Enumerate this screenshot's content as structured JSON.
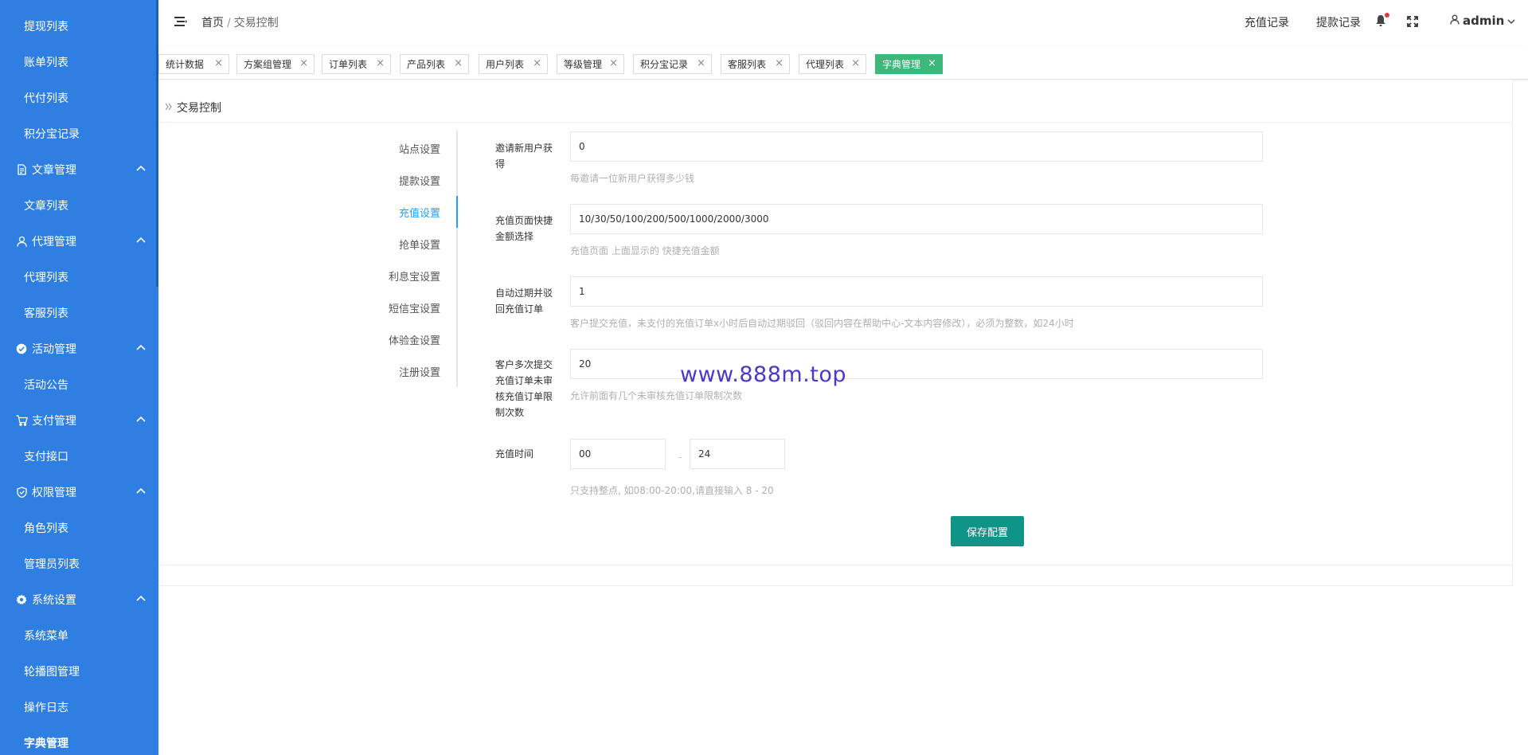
{
  "colors": {
    "sidebar_bg": "#2f7fe3",
    "accent": "#1e9fff",
    "tab_active": "#3cb87a",
    "save_button": "#119488"
  },
  "sidebar": {
    "items": [
      {
        "label": "提现列表",
        "type": "sub"
      },
      {
        "label": "账单列表",
        "type": "sub"
      },
      {
        "label": "代付列表",
        "type": "sub"
      },
      {
        "label": "积分宝记录",
        "type": "sub"
      },
      {
        "label": "文章管理",
        "type": "group",
        "icon": "document-icon"
      },
      {
        "label": "文章列表",
        "type": "sub"
      },
      {
        "label": "代理管理",
        "type": "group",
        "icon": "user-icon"
      },
      {
        "label": "代理列表",
        "type": "sub"
      },
      {
        "label": "客服列表",
        "type": "sub"
      },
      {
        "label": "活动管理",
        "type": "group",
        "icon": "activity-icon"
      },
      {
        "label": "活动公告",
        "type": "sub"
      },
      {
        "label": "支付管理",
        "type": "group",
        "icon": "cart-icon"
      },
      {
        "label": "支付接口",
        "type": "sub"
      },
      {
        "label": "权限管理",
        "type": "group",
        "icon": "shield-icon"
      },
      {
        "label": "角色列表",
        "type": "sub"
      },
      {
        "label": "管理员列表",
        "type": "sub"
      },
      {
        "label": "系统设置",
        "type": "group",
        "icon": "gear-icon"
      },
      {
        "label": "系统菜单",
        "type": "sub"
      },
      {
        "label": "轮播图管理",
        "type": "sub"
      },
      {
        "label": "操作日志",
        "type": "sub"
      },
      {
        "label": "字典管理",
        "type": "sub",
        "active": true
      }
    ]
  },
  "header": {
    "breadcrumb": {
      "home": "首页",
      "separator": "/",
      "current": "交易控制"
    },
    "links": {
      "recharge_records": "充值记录",
      "withdraw_records": "提款记录"
    },
    "user": "admin"
  },
  "tabs": [
    {
      "label": "统计数据"
    },
    {
      "label": "方案组管理"
    },
    {
      "label": "订单列表"
    },
    {
      "label": "产品列表"
    },
    {
      "label": "用户列表"
    },
    {
      "label": "等级管理"
    },
    {
      "label": "积分宝记录"
    },
    {
      "label": "客服列表"
    },
    {
      "label": "代理列表"
    },
    {
      "label": "字典管理",
      "active": true
    }
  ],
  "panel": {
    "title": "交易控制",
    "vtabs": [
      {
        "label": "站点设置"
      },
      {
        "label": "提款设置"
      },
      {
        "label": "充值设置",
        "active": true
      },
      {
        "label": "抢单设置"
      },
      {
        "label": "利息宝设置"
      },
      {
        "label": "短信宝设置"
      },
      {
        "label": "体验金设置"
      },
      {
        "label": "注册设置"
      }
    ],
    "fields": {
      "invite": {
        "label": "邀请新用户获得",
        "value": "0",
        "hint": "每邀请一位新用户获得多少钱"
      },
      "quick_amounts": {
        "label": "充值页面快捷金额选择",
        "value": "10/30/50/100/200/500/1000/2000/3000",
        "hint": "充值页面 上面显示的 快捷充值金额"
      },
      "auto_expire": {
        "label": "自动过期并驳回充值订单",
        "value": "1",
        "hint": "客户提交充值，未支付的充值订单x小时后自动过期驳回（驳回内容在帮助中心-文本内容修改），必须为整数，如24小时"
      },
      "multi_submit": {
        "label": "客户多次提交充值订单未审核充值订单限制次数",
        "value": "20",
        "hint": "允许前面有几个未审核充值订单限制次数"
      },
      "recharge_time": {
        "label": "充值时间",
        "start": "00",
        "end": "24",
        "separator": "-",
        "hint": "只支持整点, 如08:00-20:00,请直接输入 8 - 20"
      }
    },
    "save_button": "保存配置"
  },
  "watermark": "www.888m.top"
}
